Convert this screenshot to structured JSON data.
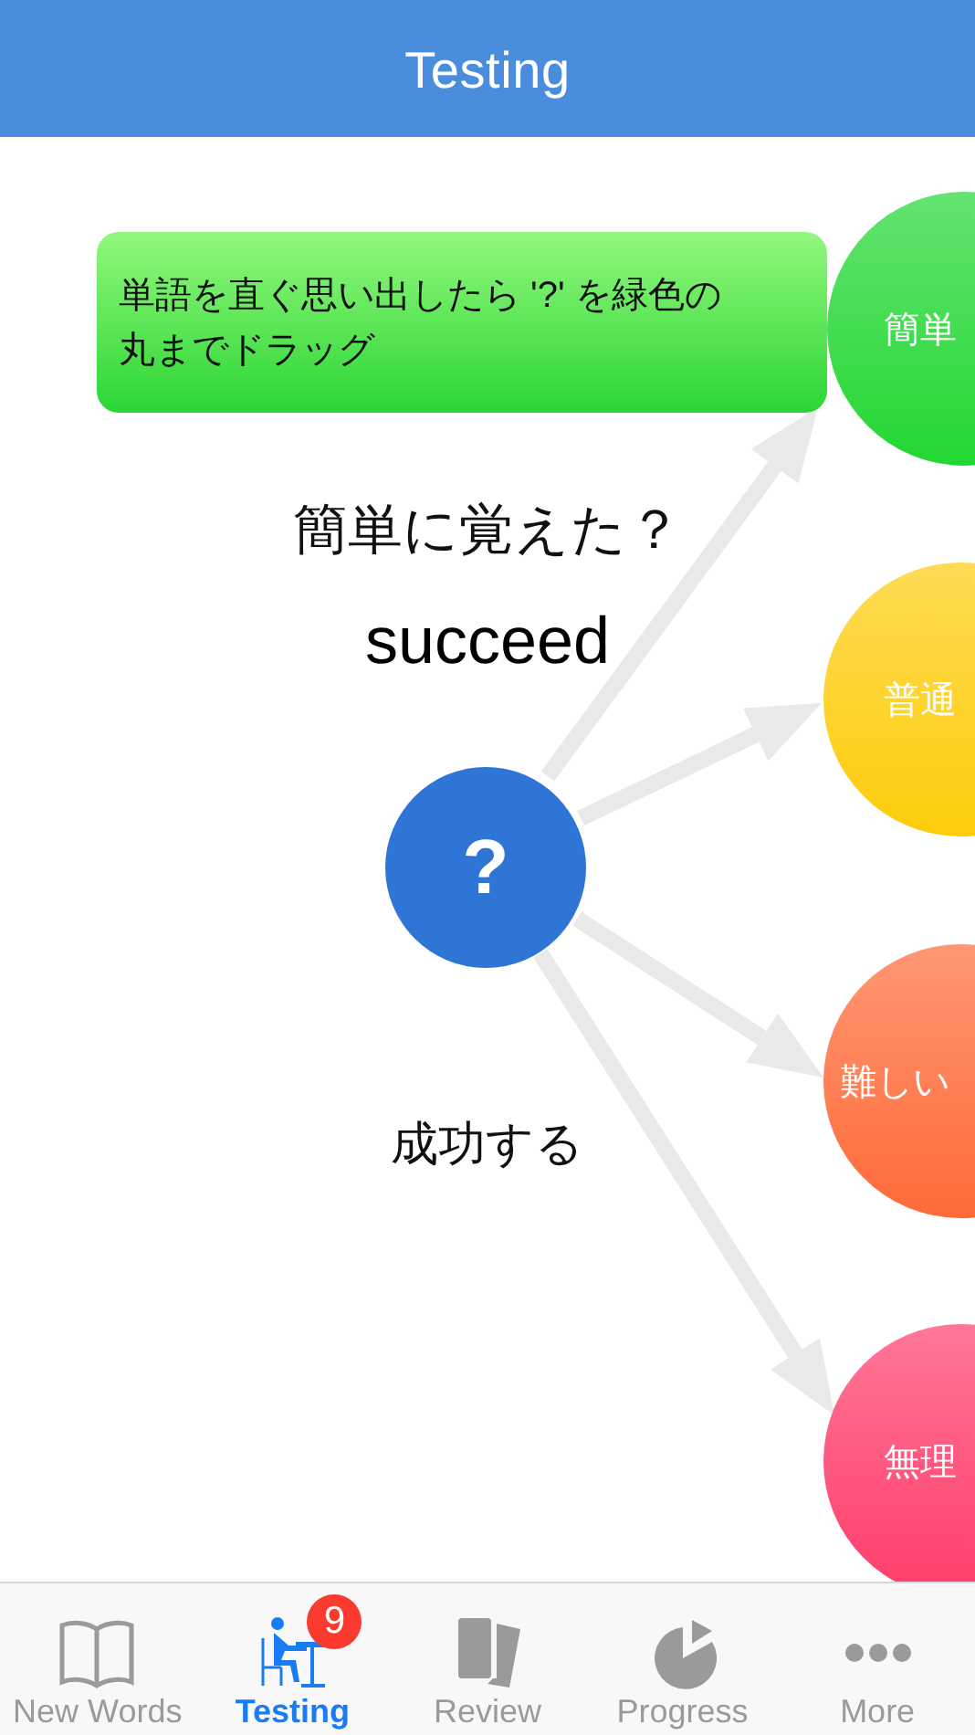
{
  "header": {
    "title": "Testing"
  },
  "hint": {
    "text": "単語を直ぐ思い出したら '?' を緑色の丸までドラッグ"
  },
  "prompt": "簡単に覚えた？",
  "word": "succeed",
  "meaning": "成功する",
  "drag_handle": "?",
  "targets": [
    {
      "label": "簡単",
      "color": "#22d733"
    },
    {
      "label": "普通",
      "color": "#fdcc0a"
    },
    {
      "label": "難しい",
      "color": "#ff6a38"
    },
    {
      "label": "無理",
      "color": "#ff3c6a"
    }
  ],
  "tabs": [
    {
      "label": "New Words",
      "kind": "book",
      "selected": false
    },
    {
      "label": "Testing",
      "kind": "desk",
      "selected": true,
      "badge": "9"
    },
    {
      "label": "Review",
      "kind": "cards",
      "selected": false
    },
    {
      "label": "Progress",
      "kind": "pie",
      "selected": false
    },
    {
      "label": "More",
      "kind": "dots",
      "selected": false
    }
  ]
}
